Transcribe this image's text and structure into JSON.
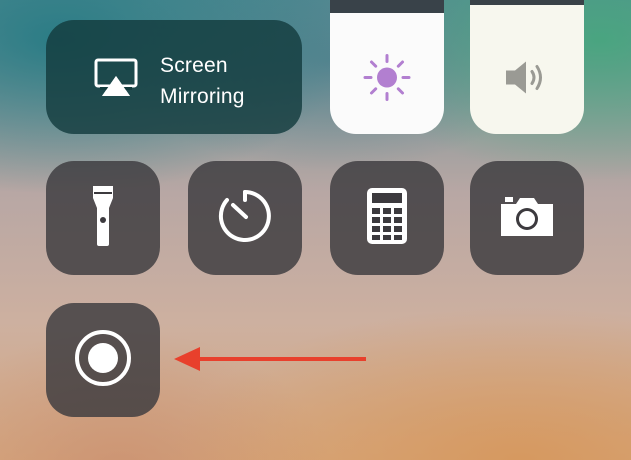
{
  "screen_mirroring": {
    "label_line1": "Screen",
    "label_line2": "Mirroring",
    "icon": "airplay-icon"
  },
  "sliders": {
    "brightness": {
      "icon": "sun-icon",
      "level": 0.9
    },
    "volume": {
      "icon": "speaker-icon",
      "level": 0.96
    }
  },
  "controls": [
    {
      "id": "flashlight",
      "icon": "flashlight-icon"
    },
    {
      "id": "timer",
      "icon": "timer-icon"
    },
    {
      "id": "calculator",
      "icon": "calculator-icon"
    },
    {
      "id": "camera",
      "icon": "camera-icon"
    },
    {
      "id": "screen-recording",
      "icon": "record-icon"
    }
  ],
  "annotation": {
    "icon": "red-arrow-icon",
    "color": "#e8402c"
  },
  "colors": {
    "tile": "#3c3a3e",
    "mirroring_tile": "#143c3e",
    "slider_fill": "#fbfbfb",
    "icon_white": "#ffffff",
    "sun_purple": "#b27fd0",
    "speaker_gray": "#9a9a94"
  }
}
